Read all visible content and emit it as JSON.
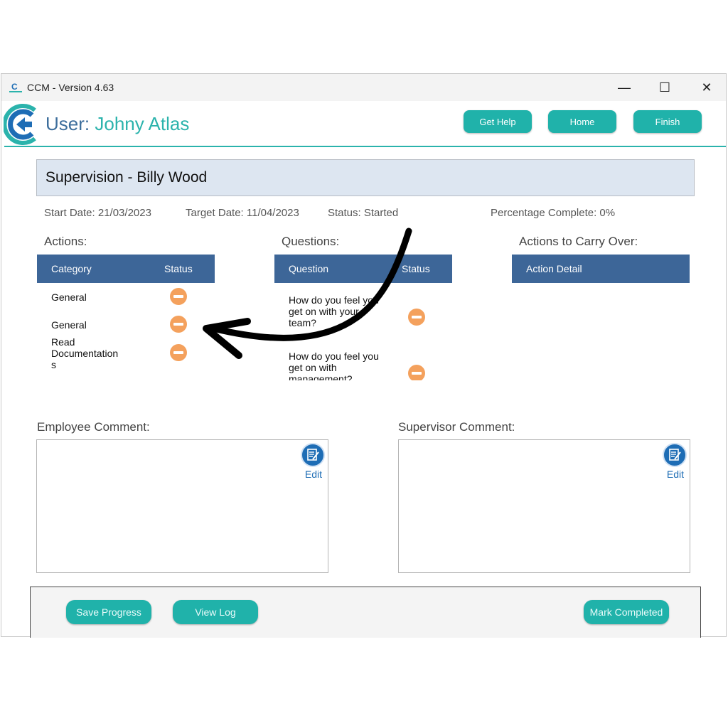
{
  "window": {
    "title": "CCM - Version 4.63",
    "controls": {
      "minimize": "—",
      "maximize": "☐",
      "close": "✕"
    }
  },
  "header": {
    "user_label": "User:",
    "user_name": "Johny Atlas",
    "buttons": {
      "help": "Get Help",
      "home": "Home",
      "finish": "Finish"
    }
  },
  "supervision": {
    "title": "Supervision - Billy Wood",
    "start_date": "Start Date: 21/03/2023",
    "target_date": "Target Date: 11/04/2023",
    "status": "Status: Started",
    "percentage": "Percentage Complete: 0%"
  },
  "actions": {
    "label": "Actions:",
    "headers": {
      "category": "Category",
      "status": "Status"
    },
    "rows": [
      {
        "category": "General",
        "status": "in-progress"
      },
      {
        "category": "General",
        "status": "in-progress"
      },
      {
        "category": "Read\nDocumentation\ns",
        "status": "in-progress"
      }
    ]
  },
  "questions": {
    "label": "Questions:",
    "headers": {
      "question": "Question",
      "status": "Status"
    },
    "rows": [
      {
        "question": "How do you feel you get on with your team?",
        "status": "in-progress"
      },
      {
        "question": "How do you feel you get on with management?",
        "status": "in-progress"
      }
    ]
  },
  "carry_over": {
    "label": "Actions to Carry Over:",
    "headers": {
      "detail": "Action Detail"
    }
  },
  "comments": {
    "employee_label": "Employee Comment:",
    "supervisor_label": "Supervisor Comment:",
    "edit_label": "Edit",
    "edit_icon": "edit-note-icon"
  },
  "footer": {
    "save": "Save Progress",
    "view_log": "View Log",
    "mark_completed": "Mark Completed"
  },
  "colors": {
    "teal": "#20b2aa",
    "header_blue": "#3d6698",
    "status_orange": "#f4a15d",
    "edit_blue": "#1e6db5"
  }
}
